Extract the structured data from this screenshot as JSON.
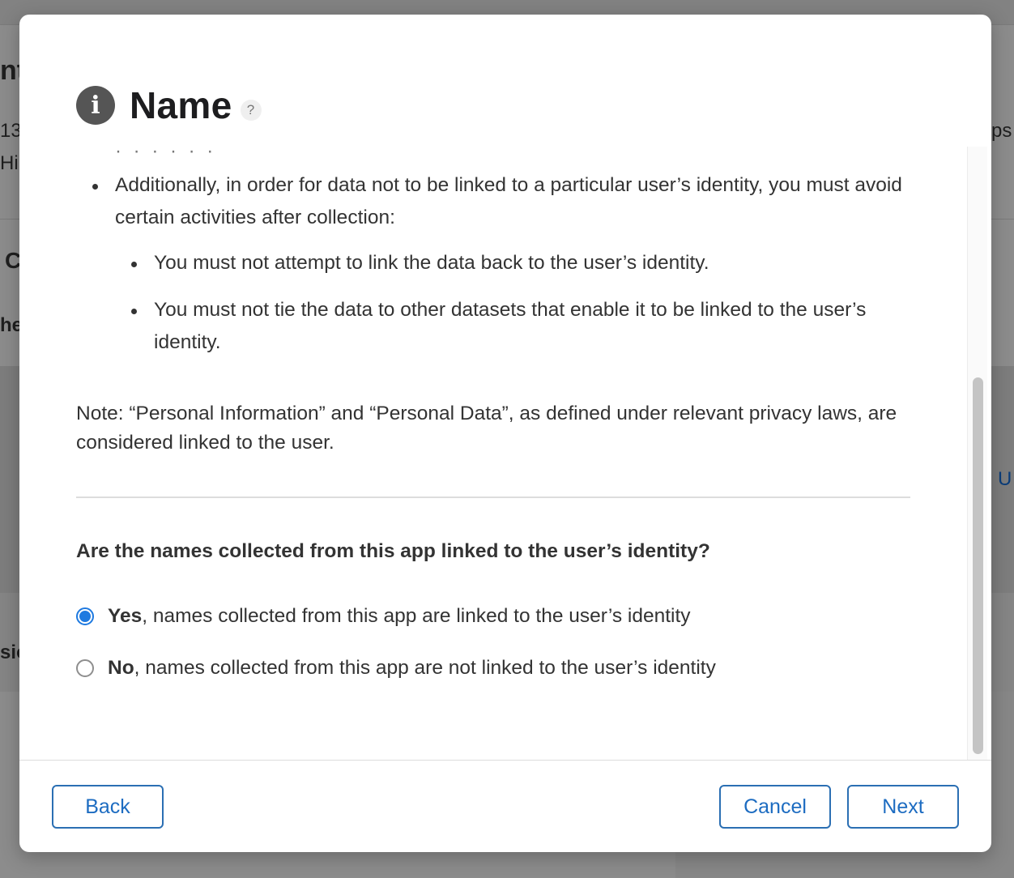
{
  "background": {
    "fragments": {
      "top_left": "nt",
      "line1_left": "13",
      "line2_left": "Hi",
      "right_1": "ps",
      "section_c": "C",
      "section_he": "he",
      "link_u": "U",
      "section_si": "sio"
    }
  },
  "dialog": {
    "title": "Name",
    "info_icon": "i",
    "help_icon": "?",
    "cut_off_text": "· · ·  · · ·",
    "bullets": {
      "main": "Additionally, in order for data not to be linked to a particular user’s identity, you must avoid certain activities after collection:",
      "sub": [
        "You must not attempt to link the data back to the user’s identity.",
        "You must not tie the data to other datasets that enable it to be linked to the user’s identity."
      ]
    },
    "note": "Note: “Personal Information” and “Personal Data”, as defined under relevant privacy laws, are considered linked to the user.",
    "question": "Are the names collected from this app linked to the user’s identity?",
    "options": {
      "yes": {
        "bold": "Yes",
        "rest": ", names collected from this app are linked to the user’s identity",
        "checked": true
      },
      "no": {
        "bold": "No",
        "rest": ", names collected from this app are not linked to the user’s identity",
        "checked": false
      }
    },
    "buttons": {
      "back": "Back",
      "cancel": "Cancel",
      "next": "Next"
    },
    "accent_color": "#1f7ae0"
  }
}
